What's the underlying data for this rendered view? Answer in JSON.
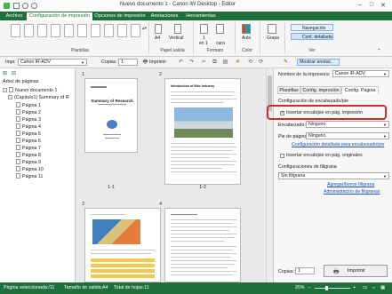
{
  "window": {
    "title": "Nuevo documento 1 - Canon iW Desktop - Editor",
    "controls": [
      "minimize",
      "maximize",
      "close"
    ]
  },
  "ribbon_tabs": [
    "Archivo",
    "Configuración de impresión",
    "Opciones de impresión",
    "Anotaciones",
    "Herramientas"
  ],
  "ribbon": {
    "groups": [
      "Plantillas",
      "Papel salida",
      "Formato",
      "Color",
      "Grapa",
      "Ver"
    ],
    "paper_size": "A4",
    "orientation": "Vertical",
    "format_n_up": "1",
    "format_on_1": "en 1",
    "duplex": "1",
    "duplex_label": "cara",
    "color": "Auto",
    "staple": "Grapa",
    "nav_btn": "Navegación",
    "conf_btn": "Conf. detallada"
  },
  "toolbar": {
    "printer_label": "Impr.",
    "printer_value": "Canon iR-ADV",
    "copies_label": "Copias",
    "copies_value": "1",
    "print_btn": "Imprimir",
    "show_annot_btn": "Mostrar anotac."
  },
  "left_panel": {
    "title": "Árbol de páginas",
    "root": "Nuevo documento 1",
    "chapter": "(Capítulo1) Summary of R",
    "pages": [
      "Página 1",
      "Página 2",
      "Página 3",
      "Página 4",
      "Página 5",
      "Página 6",
      "Página 7",
      "Página 8",
      "Página 9",
      "Página 10",
      "Página 11"
    ]
  },
  "preview": {
    "pages": [
      {
        "number": "1",
        "label": "1-1",
        "title": "Summary of Research"
      },
      {
        "number": "2",
        "label": "1-2",
        "title": "Introduction of Bike Industry"
      },
      {
        "number": "3",
        "label": "",
        "title": ""
      },
      {
        "number": "4",
        "label": "",
        "title": ""
      }
    ]
  },
  "right_panel": {
    "printer_name_label": "Nombre de la impresora:",
    "printer_name_value": "Canon iR-ADV",
    "tabs": [
      "Plantillas",
      "Config. impresión",
      "Config. Página"
    ],
    "section_title": "Configuración de encabezado/pie",
    "insert_header_footer": "Insertar encab/pie en pág. impresión",
    "header_label": "Encabezado:",
    "header_value": "Ninguno",
    "footer_label": "Pie de página:",
    "footer_value": "Ninguno",
    "detail_link": "Configuración detallada para encabezado/pie",
    "insert_original": "Insertar encab/pie en pág. originales",
    "watermark_title": "Configuraciones de filigrana",
    "watermark_value": "Sin filigrana",
    "add_watermark_link": "Agregar/borrar filigrana",
    "manage_watermark_link": "Administración de filigranas",
    "copies_label": "Copias:",
    "copies_value": "1",
    "print_btn": "Imprimir"
  },
  "status_bar": {
    "selected_page": "Página seleccionada:/11",
    "output_size": "Tamaño de salida:A4",
    "total_sheets": "Total de hojas:11",
    "zoom": "25%"
  },
  "colors": {
    "accent": "#1f6f3b",
    "highlight": "#d62828",
    "link": "#1a55c0"
  }
}
